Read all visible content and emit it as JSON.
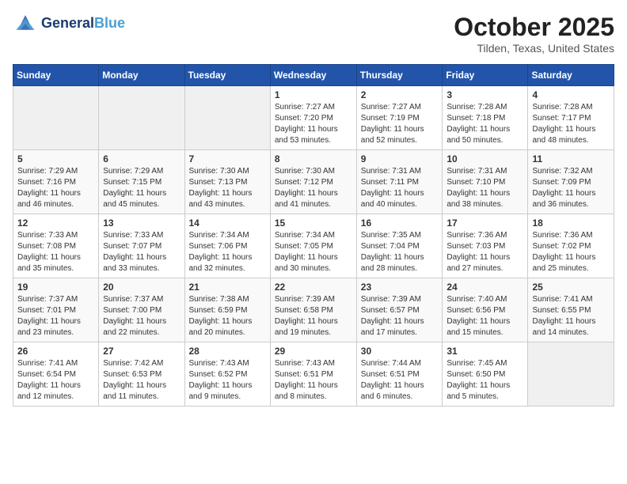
{
  "header": {
    "logo_line1": "General",
    "logo_line2": "Blue",
    "month": "October 2025",
    "location": "Tilden, Texas, United States"
  },
  "weekdays": [
    "Sunday",
    "Monday",
    "Tuesday",
    "Wednesday",
    "Thursday",
    "Friday",
    "Saturday"
  ],
  "weeks": [
    [
      {
        "day": "",
        "info": ""
      },
      {
        "day": "",
        "info": ""
      },
      {
        "day": "",
        "info": ""
      },
      {
        "day": "1",
        "info": "Sunrise: 7:27 AM\nSunset: 7:20 PM\nDaylight: 11 hours\nand 53 minutes."
      },
      {
        "day": "2",
        "info": "Sunrise: 7:27 AM\nSunset: 7:19 PM\nDaylight: 11 hours\nand 52 minutes."
      },
      {
        "day": "3",
        "info": "Sunrise: 7:28 AM\nSunset: 7:18 PM\nDaylight: 11 hours\nand 50 minutes."
      },
      {
        "day": "4",
        "info": "Sunrise: 7:28 AM\nSunset: 7:17 PM\nDaylight: 11 hours\nand 48 minutes."
      }
    ],
    [
      {
        "day": "5",
        "info": "Sunrise: 7:29 AM\nSunset: 7:16 PM\nDaylight: 11 hours\nand 46 minutes."
      },
      {
        "day": "6",
        "info": "Sunrise: 7:29 AM\nSunset: 7:15 PM\nDaylight: 11 hours\nand 45 minutes."
      },
      {
        "day": "7",
        "info": "Sunrise: 7:30 AM\nSunset: 7:13 PM\nDaylight: 11 hours\nand 43 minutes."
      },
      {
        "day": "8",
        "info": "Sunrise: 7:30 AM\nSunset: 7:12 PM\nDaylight: 11 hours\nand 41 minutes."
      },
      {
        "day": "9",
        "info": "Sunrise: 7:31 AM\nSunset: 7:11 PM\nDaylight: 11 hours\nand 40 minutes."
      },
      {
        "day": "10",
        "info": "Sunrise: 7:31 AM\nSunset: 7:10 PM\nDaylight: 11 hours\nand 38 minutes."
      },
      {
        "day": "11",
        "info": "Sunrise: 7:32 AM\nSunset: 7:09 PM\nDaylight: 11 hours\nand 36 minutes."
      }
    ],
    [
      {
        "day": "12",
        "info": "Sunrise: 7:33 AM\nSunset: 7:08 PM\nDaylight: 11 hours\nand 35 minutes."
      },
      {
        "day": "13",
        "info": "Sunrise: 7:33 AM\nSunset: 7:07 PM\nDaylight: 11 hours\nand 33 minutes."
      },
      {
        "day": "14",
        "info": "Sunrise: 7:34 AM\nSunset: 7:06 PM\nDaylight: 11 hours\nand 32 minutes."
      },
      {
        "day": "15",
        "info": "Sunrise: 7:34 AM\nSunset: 7:05 PM\nDaylight: 11 hours\nand 30 minutes."
      },
      {
        "day": "16",
        "info": "Sunrise: 7:35 AM\nSunset: 7:04 PM\nDaylight: 11 hours\nand 28 minutes."
      },
      {
        "day": "17",
        "info": "Sunrise: 7:36 AM\nSunset: 7:03 PM\nDaylight: 11 hours\nand 27 minutes."
      },
      {
        "day": "18",
        "info": "Sunrise: 7:36 AM\nSunset: 7:02 PM\nDaylight: 11 hours\nand 25 minutes."
      }
    ],
    [
      {
        "day": "19",
        "info": "Sunrise: 7:37 AM\nSunset: 7:01 PM\nDaylight: 11 hours\nand 23 minutes."
      },
      {
        "day": "20",
        "info": "Sunrise: 7:37 AM\nSunset: 7:00 PM\nDaylight: 11 hours\nand 22 minutes."
      },
      {
        "day": "21",
        "info": "Sunrise: 7:38 AM\nSunset: 6:59 PM\nDaylight: 11 hours\nand 20 minutes."
      },
      {
        "day": "22",
        "info": "Sunrise: 7:39 AM\nSunset: 6:58 PM\nDaylight: 11 hours\nand 19 minutes."
      },
      {
        "day": "23",
        "info": "Sunrise: 7:39 AM\nSunset: 6:57 PM\nDaylight: 11 hours\nand 17 minutes."
      },
      {
        "day": "24",
        "info": "Sunrise: 7:40 AM\nSunset: 6:56 PM\nDaylight: 11 hours\nand 15 minutes."
      },
      {
        "day": "25",
        "info": "Sunrise: 7:41 AM\nSunset: 6:55 PM\nDaylight: 11 hours\nand 14 minutes."
      }
    ],
    [
      {
        "day": "26",
        "info": "Sunrise: 7:41 AM\nSunset: 6:54 PM\nDaylight: 11 hours\nand 12 minutes."
      },
      {
        "day": "27",
        "info": "Sunrise: 7:42 AM\nSunset: 6:53 PM\nDaylight: 11 hours\nand 11 minutes."
      },
      {
        "day": "28",
        "info": "Sunrise: 7:43 AM\nSunset: 6:52 PM\nDaylight: 11 hours\nand 9 minutes."
      },
      {
        "day": "29",
        "info": "Sunrise: 7:43 AM\nSunset: 6:51 PM\nDaylight: 11 hours\nand 8 minutes."
      },
      {
        "day": "30",
        "info": "Sunrise: 7:44 AM\nSunset: 6:51 PM\nDaylight: 11 hours\nand 6 minutes."
      },
      {
        "day": "31",
        "info": "Sunrise: 7:45 AM\nSunset: 6:50 PM\nDaylight: 11 hours\nand 5 minutes."
      },
      {
        "day": "",
        "info": ""
      }
    ]
  ]
}
